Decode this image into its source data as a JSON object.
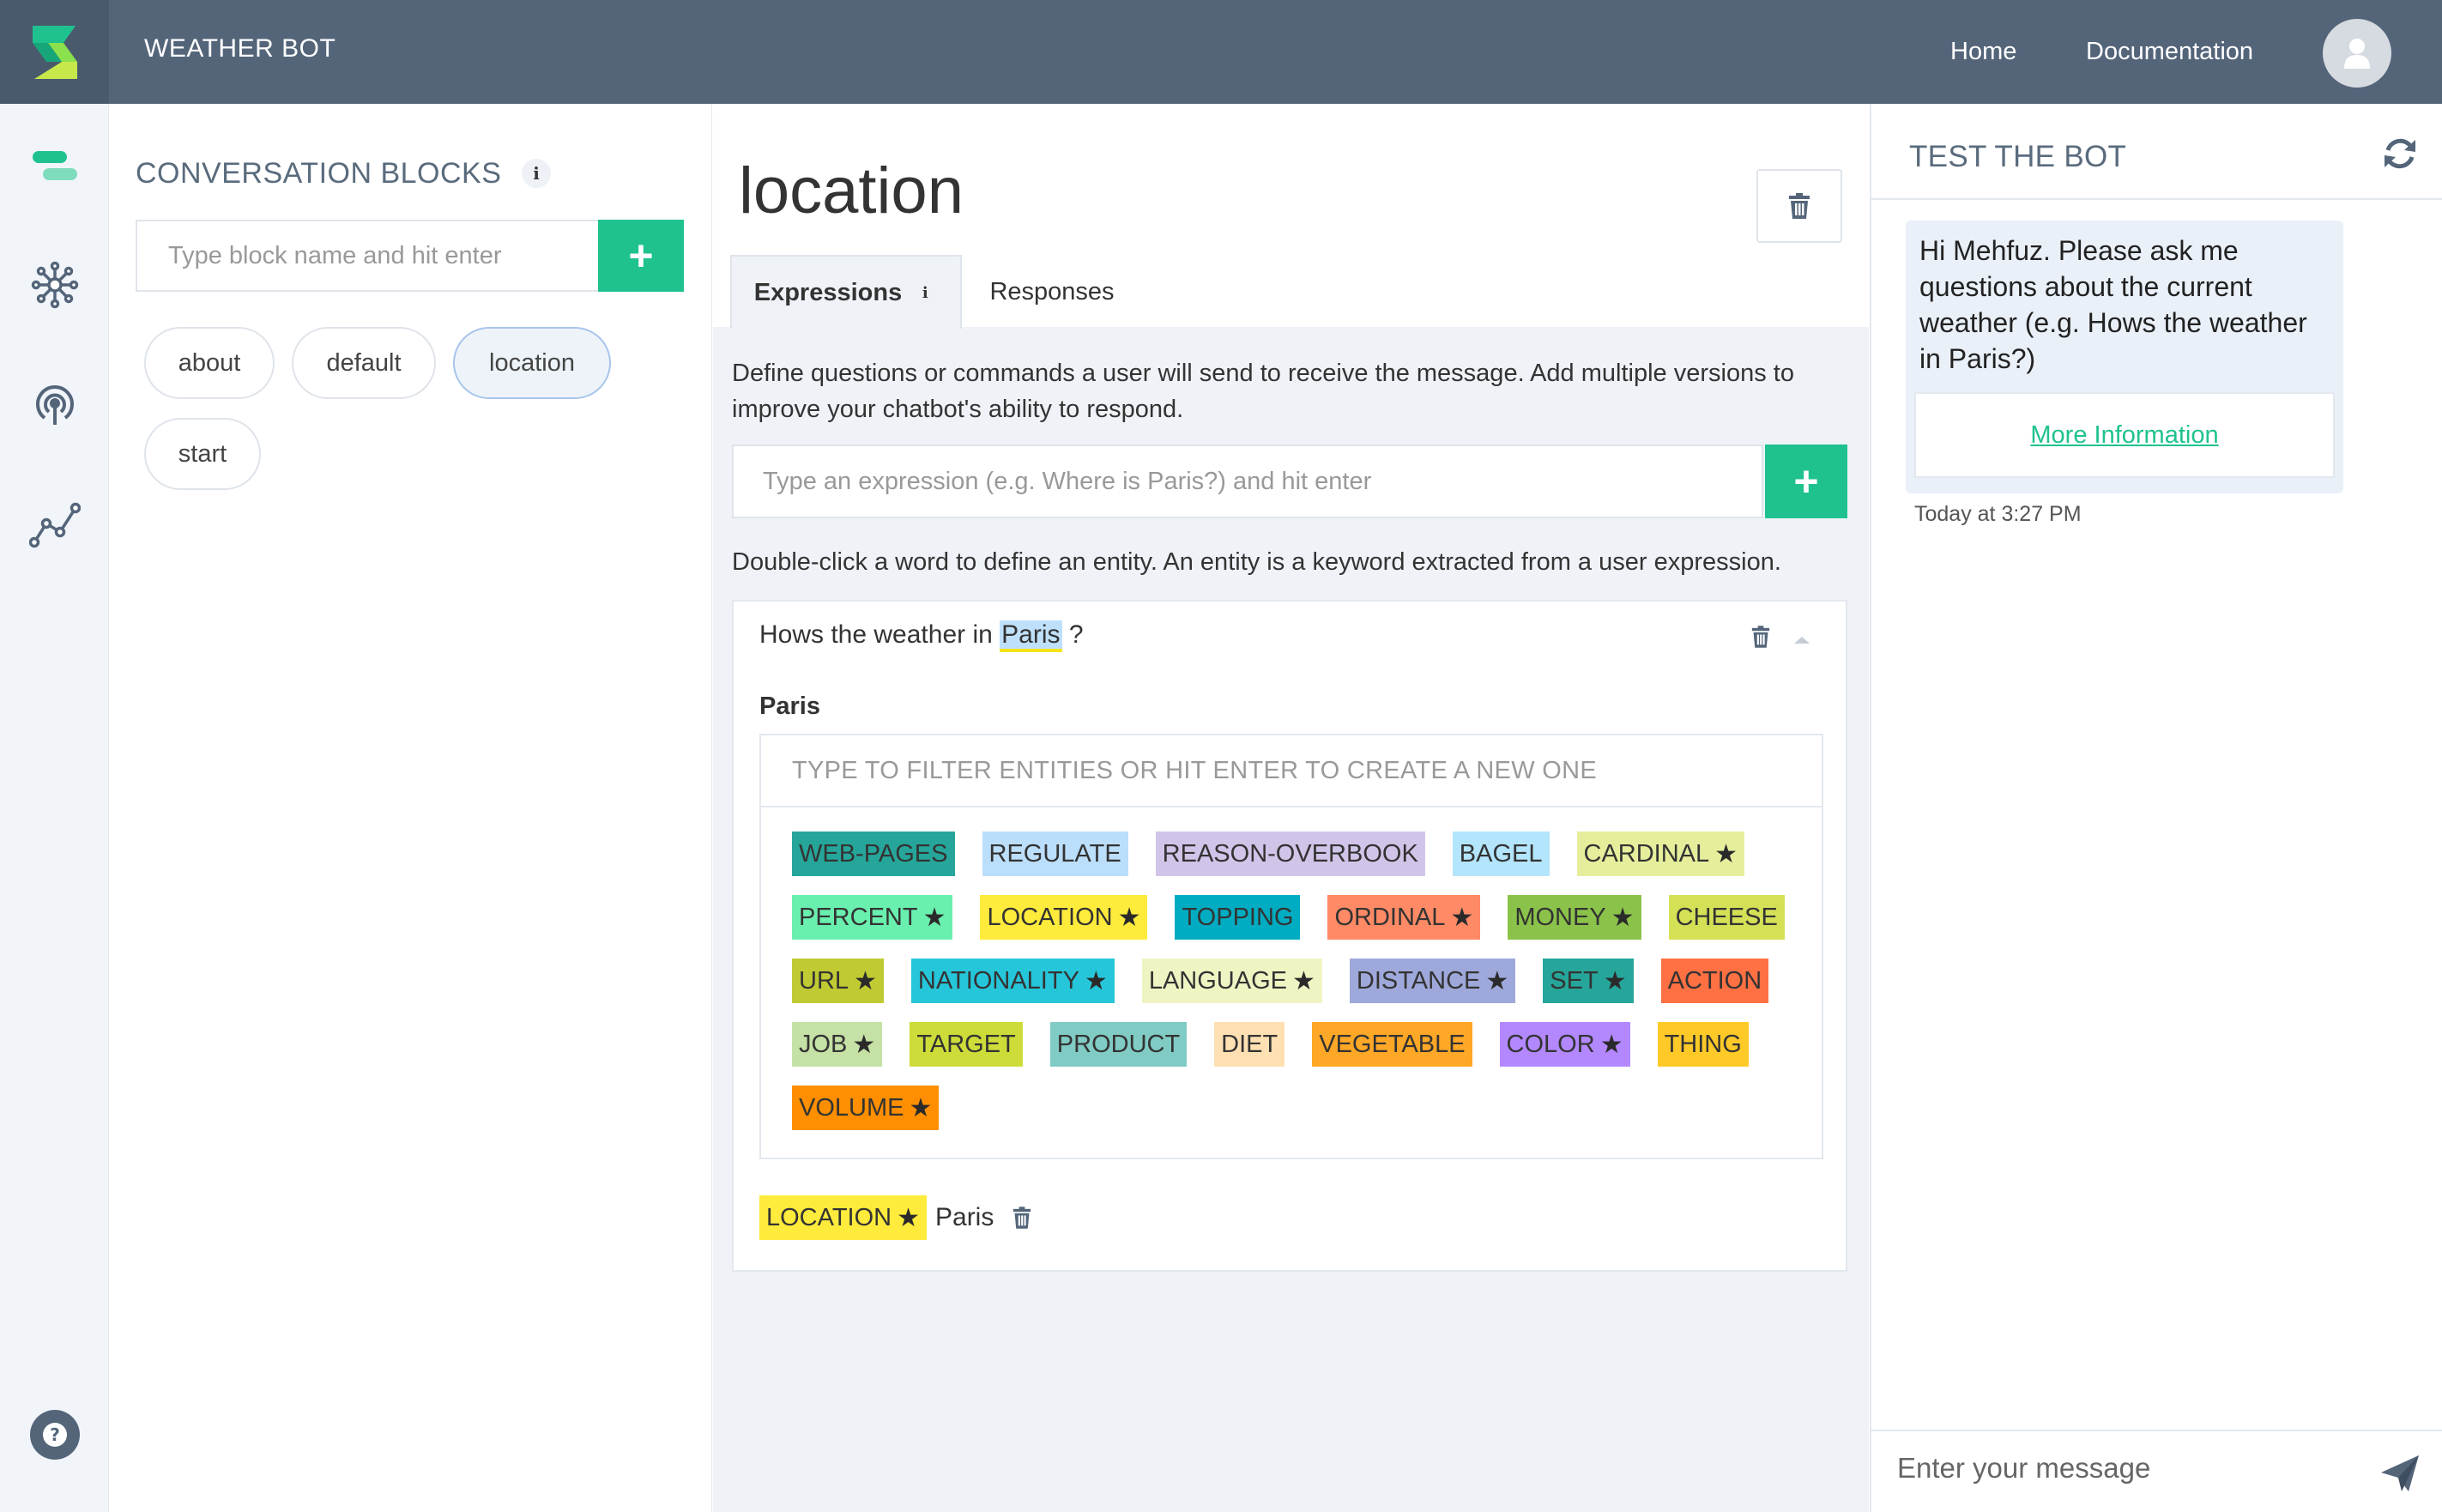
{
  "header": {
    "app_title": "WEATHER BOT",
    "nav": [
      "Home",
      "Documentation"
    ],
    "colors": {
      "bar": "#54657a",
      "accent": "#1fc28f"
    }
  },
  "rail": {
    "icons": [
      "blocks-icon",
      "entities-icon",
      "broadcast-icon",
      "analytics-icon",
      "help-icon"
    ]
  },
  "blocks": {
    "title": "CONVERSATION BLOCKS",
    "info": "i",
    "input_placeholder": "Type block name and hit enter",
    "add": "+",
    "items": [
      "about",
      "default",
      "location",
      "start"
    ],
    "active": "location"
  },
  "main": {
    "title": "location",
    "tabs": [
      {
        "label": "Expressions",
        "info": "i"
      },
      {
        "label": "Responses"
      }
    ],
    "description": "Define questions or commands a user will send to receive the message. Add multiple versions to improve your chatbot's ability to respond.",
    "expression_placeholder": "Type an expression (e.g. Where is Paris?) and hit enter",
    "add": "+",
    "entity_hint": "Double-click a word to define an entity. An entity is a keyword extracted from a user expression.",
    "expression": {
      "before": "Hows the weather in ",
      "highlight": "Paris",
      "after": " ?"
    },
    "selected_word": "Paris",
    "filter_placeholder": "TYPE TO FILTER ENTITIES OR HIT ENTER TO CREATE A NEW ONE",
    "entities": [
      {
        "label": "WEB-PAGES",
        "color": "#26a69a",
        "star": false
      },
      {
        "label": "REGULATE",
        "color": "#bbdefb",
        "star": false
      },
      {
        "label": "REASON-OVERBOOK",
        "color": "#d1c4e9",
        "star": false
      },
      {
        "label": "BAGEL",
        "color": "#b3e5fc",
        "star": false
      },
      {
        "label": "CARDINAL",
        "color": "#e6ee9c",
        "star": true
      },
      {
        "label": "PERCENT",
        "color": "#69f0ae",
        "star": true
      },
      {
        "label": "LOCATION",
        "color": "#ffeb3b",
        "star": true
      },
      {
        "label": "TOPPING",
        "color": "#00acc1",
        "star": false
      },
      {
        "label": "ORDINAL",
        "color": "#ff8a65",
        "star": true
      },
      {
        "label": "MONEY",
        "color": "#8bc34a",
        "star": true
      },
      {
        "label": "CHEESE",
        "color": "#d4e157",
        "star": false
      },
      {
        "label": "URL",
        "color": "#c0ca33",
        "star": true
      },
      {
        "label": "NATIONALITY",
        "color": "#26c6da",
        "star": true
      },
      {
        "label": "LANGUAGE",
        "color": "#f0f4c3",
        "star": true
      },
      {
        "label": "DISTANCE",
        "color": "#9fa8da",
        "star": true
      },
      {
        "label": "SET",
        "color": "#26a69a",
        "star": true
      },
      {
        "label": "ACTION",
        "color": "#ff7043",
        "star": false
      },
      {
        "label": "JOB",
        "color": "#c5e1a5",
        "star": true
      },
      {
        "label": "TARGET",
        "color": "#cddc39",
        "star": false
      },
      {
        "label": "PRODUCT",
        "color": "#80cbc4",
        "star": false
      },
      {
        "label": "DIET",
        "color": "#ffe0b2",
        "star": false
      },
      {
        "label": "VEGETABLE",
        "color": "#ffa726",
        "star": false
      },
      {
        "label": "COLOR",
        "color": "#b388ff",
        "star": true
      },
      {
        "label": "THING",
        "color": "#ffca28",
        "star": false
      },
      {
        "label": "VOLUME",
        "color": "#ff8f00",
        "star": true
      }
    ],
    "assigned": {
      "entity": "LOCATION",
      "color": "#ffeb3b",
      "value": "Paris"
    }
  },
  "test": {
    "title": "TEST THE BOT",
    "bot_message": "Hi Mehfuz. Please ask me questions about the current weather (e.g. Hows the weather in Paris?)",
    "button_label": "More Information",
    "timestamp": "Today at 3:27 PM",
    "input_placeholder": "Enter your message"
  }
}
